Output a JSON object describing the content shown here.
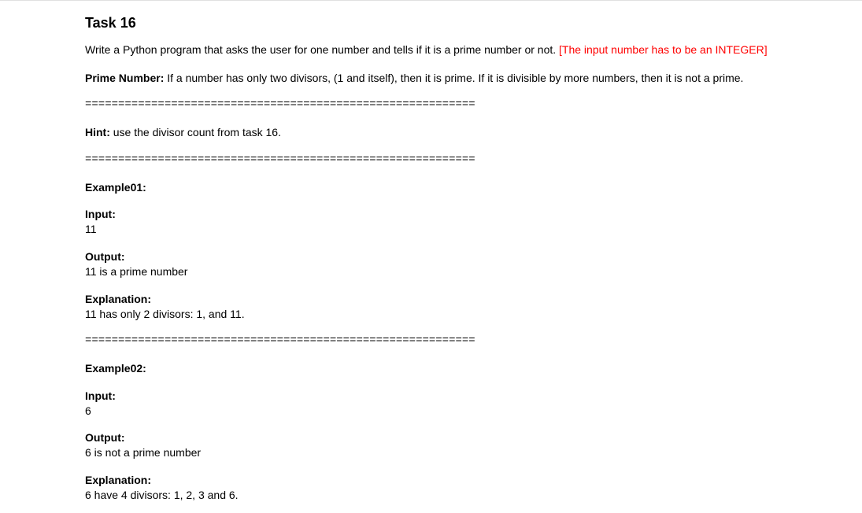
{
  "task": {
    "title": "Task 16",
    "description_main": "Write a Python program that asks the user for one number and tells if it is a prime number or not. ",
    "description_red": "[The input number has to be an INTEGER]",
    "prime_label": "Prime Number: ",
    "prime_def": "If a number has only two divisors, (1 and itself), then it is prime. If it is divisible by more numbers, then it is not a prime.",
    "divider": "===========================================================",
    "hint_label": "Hint: ",
    "hint_text": "use the divisor count from task 16.",
    "ex1": {
      "label": "Example01:",
      "input_label": "Input:",
      "input_value": "11",
      "output_label": "Output:",
      "output_value": "11 is a prime number",
      "explanation_label": "Explanation:",
      "explanation_value": "11 has only 2 divisors: 1, and 11."
    },
    "ex2": {
      "label": "Example02:",
      "input_label": "Input:",
      "input_value": "6",
      "output_label": "Output:",
      "output_value": "6 is not a prime number",
      "explanation_label": "Explanation:",
      "explanation_value": "6 have 4 divisors: 1, 2, 3 and 6."
    }
  }
}
